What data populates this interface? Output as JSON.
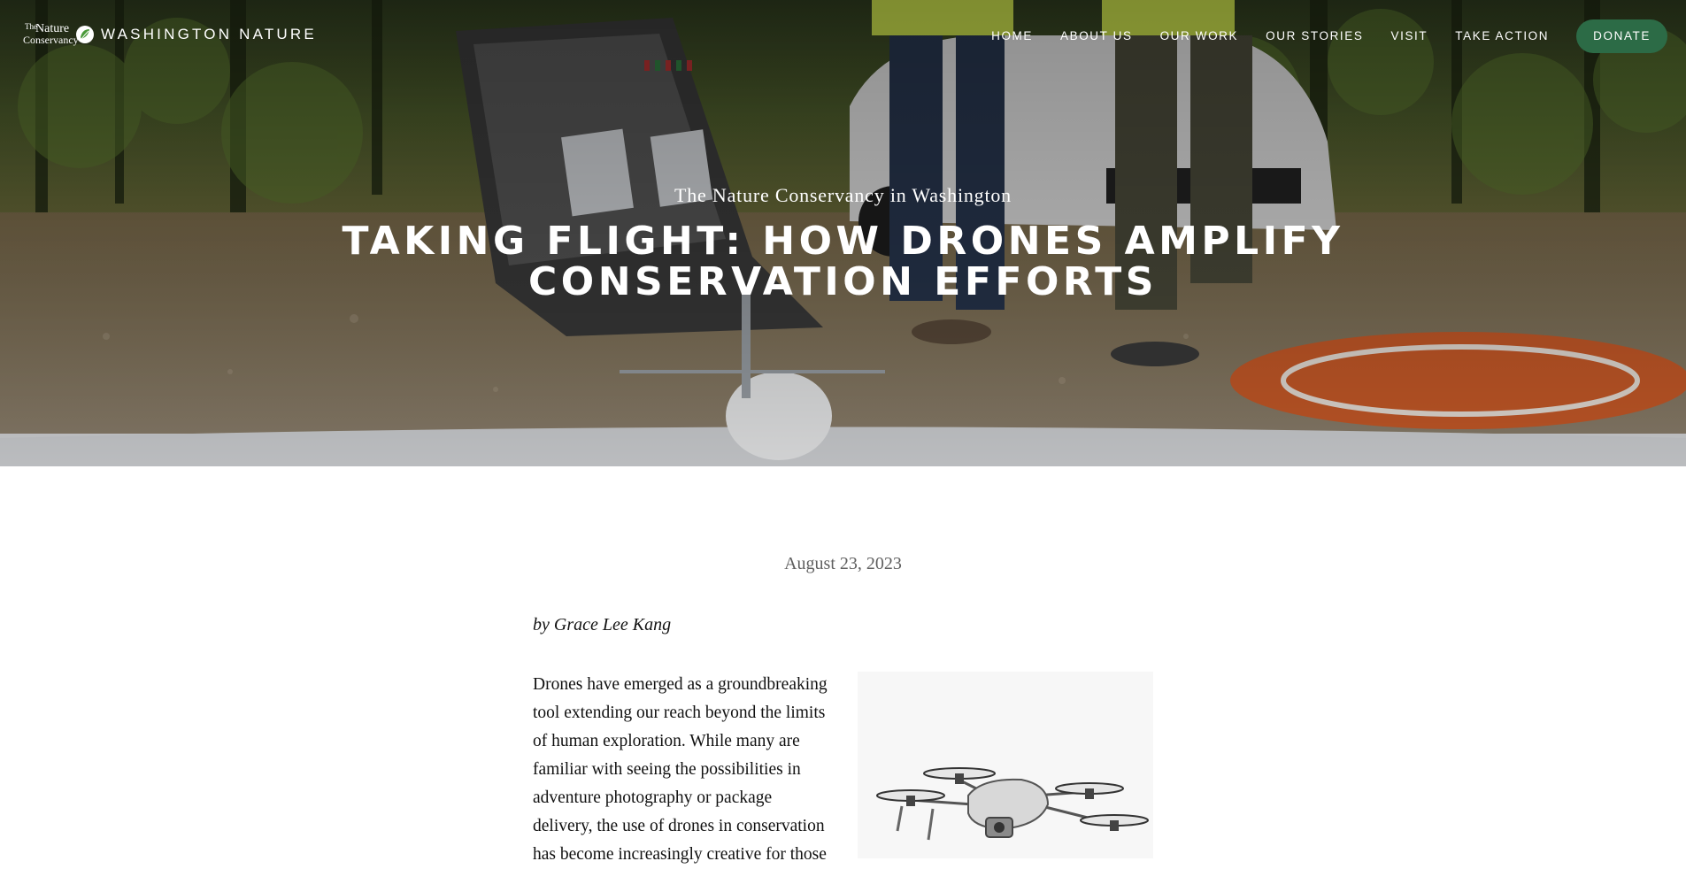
{
  "header": {
    "site_name": "WASHINGTON NATURE",
    "logo": {
      "line_the": "The",
      "line_nature": "Nature",
      "line_conservancy": "Conservancy"
    },
    "nav": [
      {
        "label": "HOME"
      },
      {
        "label": "ABOUT US"
      },
      {
        "label": "OUR WORK"
      },
      {
        "label": "OUR STORIES"
      },
      {
        "label": "VISIT"
      },
      {
        "label": "TAKE ACTION"
      }
    ],
    "donate_label": "DONATE"
  },
  "hero": {
    "kicker": "The Nature Conservancy in Washington",
    "title_line1": "TAKING FLIGHT: HOW DRONES AMPLIFY",
    "title_line2": "CONSERVATION EFFORTS"
  },
  "article": {
    "date": "August 23, 2023",
    "byline": "by Grace Lee Kang",
    "paragraph": "Drones have emerged as a groundbreaking tool extending our reach beyond the limits of human exploration. While many are familiar with seeing the possibilities in adventure photography or package delivery, the use of drones in conservation has become increasingly creative for those"
  },
  "colors": {
    "donate_bg": "#2c6b46",
    "hero_overlay": "#000000",
    "text": "#111111",
    "date_text": "#5f5f5f"
  }
}
